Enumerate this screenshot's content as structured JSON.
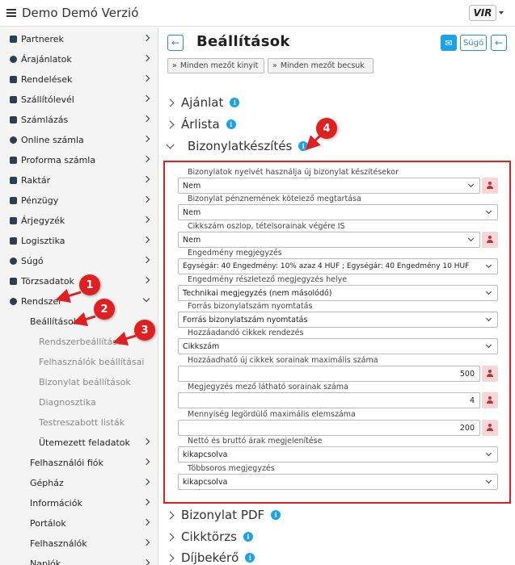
{
  "app": {
    "title": "Demo Demó Verzió",
    "logo_text": "VIR"
  },
  "sidebar": {
    "items": [
      {
        "label": "Partnerek"
      },
      {
        "label": "Árajánlatok"
      },
      {
        "label": "Rendelések"
      },
      {
        "label": "Szállítólevél"
      },
      {
        "label": "Számlázás"
      },
      {
        "label": "Online számla"
      },
      {
        "label": "Proforma számla"
      },
      {
        "label": "Raktár"
      },
      {
        "label": "Pénzügy"
      },
      {
        "label": "Árjegyzék"
      },
      {
        "label": "Logisztika"
      },
      {
        "label": "Súgó"
      },
      {
        "label": "Törzsadatok"
      },
      {
        "label": "Rendszer"
      }
    ],
    "sub": {
      "beallitasok": "Beállítások",
      "rendszerbeallitasok": "Rendszerbeállítások",
      "felhasznalok_beallitasai": "Felhasználók beállításai",
      "bizonylat_beallitasok": "Bizonylat beállítások",
      "diagnosztika": "Diagnosztika",
      "testreszabott_listak": "Testreszabott listák",
      "utemezett_feladatok": "Ütemezett feladatok",
      "felhasznaloi_fiok": "Felhasználói fiók",
      "gephaz": "Gépház",
      "informaciok": "Információk",
      "portalok": "Portálok",
      "felhasznalok": "Felhasználók",
      "naplok": "Naplók"
    }
  },
  "header": {
    "title": "Beállítások",
    "help_label": "Súgó",
    "expand_all": "Minden mezőt kinyit",
    "collapse_all": "Minden mezőt becsuk"
  },
  "sections": {
    "ajanlat": "Ajánlat",
    "arlista": "Árlista",
    "bizonylatkeszites": "Bizonylatkészítés",
    "bizonylat_pdf": "Bizonylat PDF",
    "cikktorzs": "Cikktörzs",
    "dijbekero": "Díjbekérő"
  },
  "fields": [
    {
      "label": "Bizonylatok nyelvét használja új bizonylat készítésekor",
      "value": "Nem"
    },
    {
      "label": "Bizonylat pénznemének kötelező megtartása",
      "value": "Nem"
    },
    {
      "label": "Cikkszám oszlop, tételsorainak végére IS",
      "value": "Nem"
    },
    {
      "label": "Engedmény megjegyzés",
      "value": "Egységár: 40 Engedmény: 10% azaz 4 HUF ; Egységár: 40 Engedmény 10 HUF"
    },
    {
      "label": "Engedmény részletező megjegyzés helye",
      "value": "Technikai megjegyzés (nem másolódó)"
    },
    {
      "label": "Forrás bizonylatszám nyomtatás",
      "value": "Forrás bizonylatszám nyomtatás"
    },
    {
      "label": "Hozzáadandó cikkek rendezés",
      "value": "Cikkszám"
    },
    {
      "label": "Hozzáadható új cikkek sorainak maximális száma",
      "value": "500"
    },
    {
      "label": "Megjegyzés mező látható sorainak száma",
      "value": "4"
    },
    {
      "label": "Mennyiség legördülő maximális elemszáma",
      "value": "200"
    },
    {
      "label": "Nettó és bruttó árak megjelenítése",
      "value": "kikapcsolva"
    },
    {
      "label": "Többsoros megjegyzés",
      "value": "kikapcsolva"
    }
  ],
  "callouts": [
    "1",
    "2",
    "3",
    "4"
  ],
  "colors": {
    "accent": "#2d8bd6",
    "info": "#1aa3e8",
    "callout": "#e02020"
  }
}
